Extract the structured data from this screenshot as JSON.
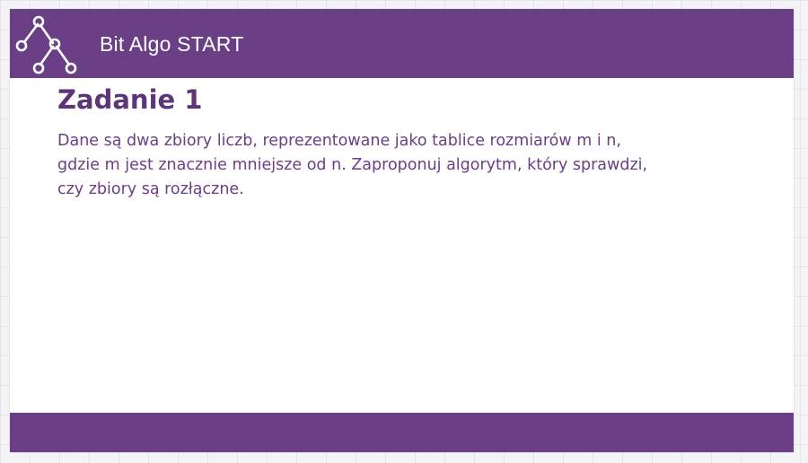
{
  "header": {
    "title": "Bit Algo START",
    "logo_icon": "tree-graph-icon"
  },
  "task": {
    "title": "Zadanie 1",
    "lines": [
      "Dane są dwa zbiory liczb, reprezentowane jako tablice rozmiarów m i n,",
      "gdzie m jest znacznie mniejsze od n. Zaproponuj algorytm, który sprawdzi,",
      "czy zbiory są rozłączne."
    ]
  },
  "colors": {
    "brand": "#6a3f86",
    "title_text": "#5d3578",
    "body_text": "#6a3f86",
    "background": "#ffffff"
  }
}
